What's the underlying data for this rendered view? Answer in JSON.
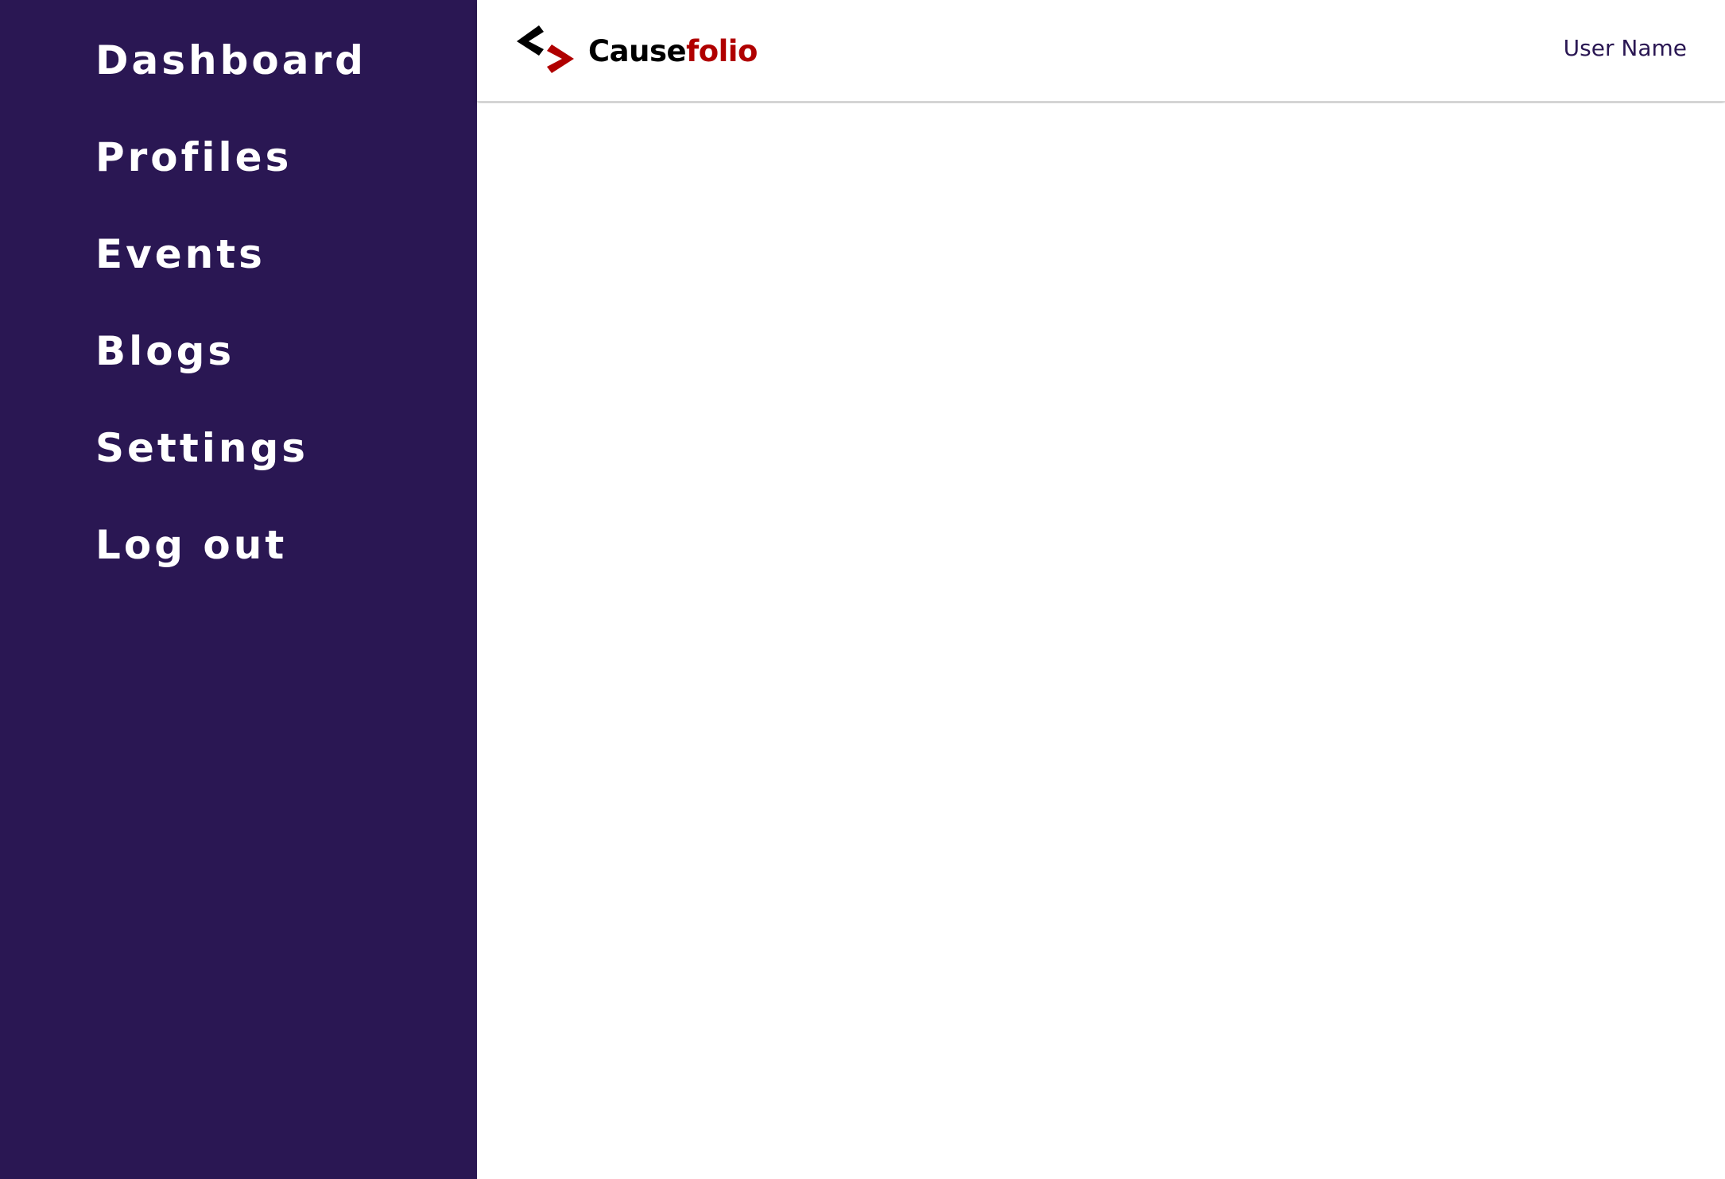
{
  "sidebar": {
    "background": "#2a1753",
    "items": [
      {
        "label": "Dashboard"
      },
      {
        "label": "Profiles"
      },
      {
        "label": "Events"
      },
      {
        "label": "Blogs"
      },
      {
        "label": "Settings"
      },
      {
        "label": "Log out"
      }
    ]
  },
  "header": {
    "logo": {
      "text_part_a": "Cause",
      "text_part_b": "folio",
      "icon": "code-brackets-icon",
      "color_a": "#000000",
      "color_b": "#b00000"
    },
    "user_name": "User Name"
  }
}
